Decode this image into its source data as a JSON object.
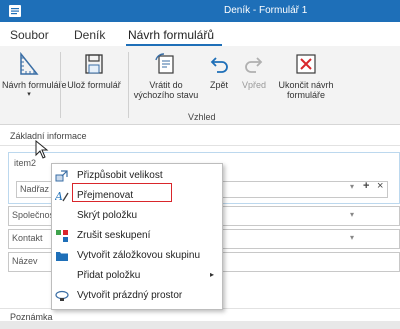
{
  "window": {
    "title": "Deník - Formulář 1"
  },
  "tabs": [
    {
      "label": "Soubor"
    },
    {
      "label": "Deník"
    },
    {
      "label": "Návrh formulářů"
    }
  ],
  "ribbon": {
    "navrh_formulare": "Návrh formuláře",
    "uloz_formular": "Ulož formulář",
    "vratit_line1": "Vrátit do",
    "vratit_line2": "výchozího stavu",
    "zpet": "Zpět",
    "vpred": "Vpřed",
    "ukoncit_line1": "Ukončit návrh",
    "ukoncit_line2": "formuláře",
    "group_vzhled": "Vzhled",
    "dropdown_glyph": "▾"
  },
  "form": {
    "section_basic": "Základní informace",
    "item_label": "item2",
    "nadraz_placeholder": "Nadřaz",
    "add_glyph": "+",
    "close_glyph": "×",
    "dropdown_glyph": "▾",
    "spolecnost": "Společnos",
    "kontakt": "Kontakt",
    "nazev": "Název",
    "poznamka": "Poznámka"
  },
  "context_menu": {
    "items": [
      {
        "label": "Přizpůsobit velikost",
        "icon": "resize-icon"
      },
      {
        "label": "Přejmenovat",
        "icon": "rename-icon"
      },
      {
        "label": "Skrýt položku",
        "icon": ""
      },
      {
        "label": "Zrušit seskupení",
        "icon": "ungroup-icon"
      },
      {
        "label": "Vytvořit záložkovou skupinu",
        "icon": "folder-icon"
      },
      {
        "label": "Přidat položku",
        "icon": "",
        "submenu": "▸"
      },
      {
        "label": "Vytvořit prázdný prostor",
        "icon": "empty-space-icon"
      }
    ]
  },
  "colors": {
    "accent": "#1e6fb8",
    "highlight": "#d9262b"
  }
}
